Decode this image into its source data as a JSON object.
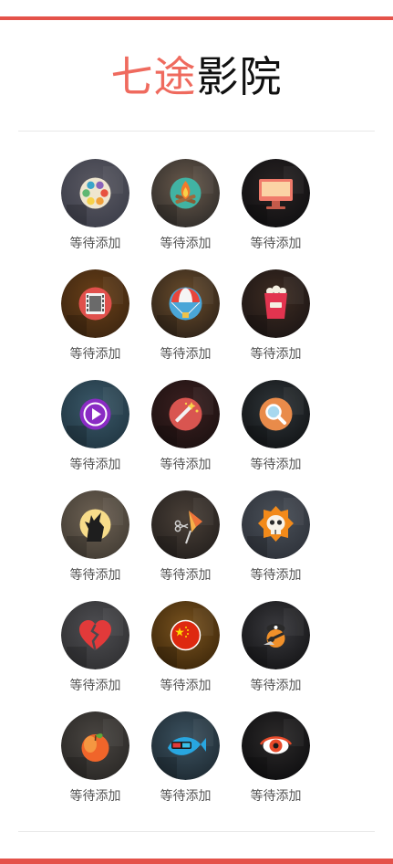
{
  "header": {
    "title_accent": "七途",
    "title_main": "影院",
    "accent_color": "#ef6a5e"
  },
  "apps": [
    {
      "label": "等待添加",
      "icon": "color-wheel-icon"
    },
    {
      "label": "等待添加",
      "icon": "campfire-icon"
    },
    {
      "label": "等待添加",
      "icon": "monitor-icon"
    },
    {
      "label": "等待添加",
      "icon": "film-strip-icon"
    },
    {
      "label": "等待添加",
      "icon": "parachute-icon"
    },
    {
      "label": "等待添加",
      "icon": "popcorn-icon"
    },
    {
      "label": "等待添加",
      "icon": "play-button-icon"
    },
    {
      "label": "等待添加",
      "icon": "magic-wand-icon"
    },
    {
      "label": "等待添加",
      "icon": "magnifier-icon"
    },
    {
      "label": "等待添加",
      "icon": "wolf-howl-icon"
    },
    {
      "label": "等待添加",
      "icon": "scissors-cut-icon"
    },
    {
      "label": "等待添加",
      "icon": "skull-badge-icon"
    },
    {
      "label": "等待添加",
      "icon": "broken-heart-icon"
    },
    {
      "label": "等待添加",
      "icon": "china-flag-icon"
    },
    {
      "label": "等待添加",
      "icon": "pirate-icon"
    },
    {
      "label": "等待添加",
      "icon": "peach-icon"
    },
    {
      "label": "等待添加",
      "icon": "fish-3d-glasses-icon"
    },
    {
      "label": "等待添加",
      "icon": "eye-icon"
    }
  ]
}
